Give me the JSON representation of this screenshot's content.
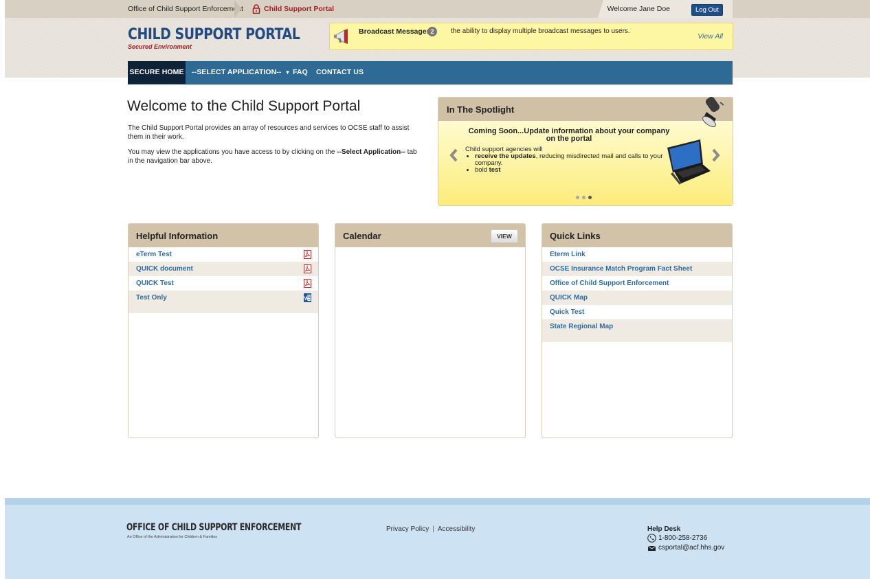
{
  "header": {
    "crumb_office": "Office of Child Support Enforcement",
    "crumb_portal": "Child Support Portal",
    "welcome": "Welcome Jane Doe",
    "logout": "Log Out",
    "logo_title": "CHILD SUPPORT PORTAL",
    "logo_subtitle": "Secured Environment"
  },
  "broadcast": {
    "title": "Broadcast Messages",
    "count": "2",
    "message": "the ability to display multiple broadcast messages to users.",
    "view_all": "View All"
  },
  "nav": {
    "home": "SECURE HOME",
    "select": "--SELECT APPLICATION--",
    "faq": "FAQ",
    "contact": "CONTACT US"
  },
  "welcome": {
    "heading": "Welcome to the Child Support Portal",
    "p1": "The Child Support Portal provides an array of resources and services to OCSE staff to assist them in their work.",
    "p2_pre": "You may view the applications you have access to by clicking on the ",
    "p2_bold": "--Select Application--",
    "p2_post": " tab in the navigation bar above."
  },
  "spotlight": {
    "title": "In The Spotlight",
    "heading": "Coming Soon...Update information about your company on the portal",
    "intro": "Child support agencies will",
    "bullet1_bold": "receive the updates",
    "bullet1_rest": ", reducing misdirected mail and calls to your company.",
    "bullet2_pre": "bold ",
    "bullet2_bold": "test",
    "active_slide": 3,
    "slide_count": 3
  },
  "helpful": {
    "title": "Helpful Information",
    "items": [
      {
        "label": "eTerm Test",
        "icon": "pdf-icon"
      },
      {
        "label": "QUICK document",
        "icon": "pdf-icon"
      },
      {
        "label": "QUICK Test",
        "icon": "pdf-icon"
      },
      {
        "label": "Test Only",
        "icon": "word-icon"
      }
    ]
  },
  "calendar": {
    "title": "Calendar",
    "view": "VIEW"
  },
  "quicklinks": {
    "title": "Quick Links",
    "items": [
      "Eterm Link",
      "OCSE Insurance Match Program Fact Sheet",
      "Office of Child Support Enforcement",
      "QUICK Map",
      "Quick Test",
      "State Regional Map"
    ]
  },
  "footer": {
    "logo_title": "OFFICE OF CHILD SUPPORT ENFORCEMENT",
    "logo_subtitle": "An Office of the Administration for Children & Families",
    "privacy": "Privacy Policy",
    "separator": "|",
    "accessibility": "Accessibility",
    "helpdesk_title": "Help Desk",
    "phone": "1-800-258-2736",
    "email": "csportal@acf.hhs.gov"
  },
  "colors": {
    "nav_bg": "#2e6a96",
    "nav_active": "#0e2238",
    "link": "#2d6ba5",
    "brand_red": "#a61f24",
    "panel_head": "#d2c3a8"
  }
}
